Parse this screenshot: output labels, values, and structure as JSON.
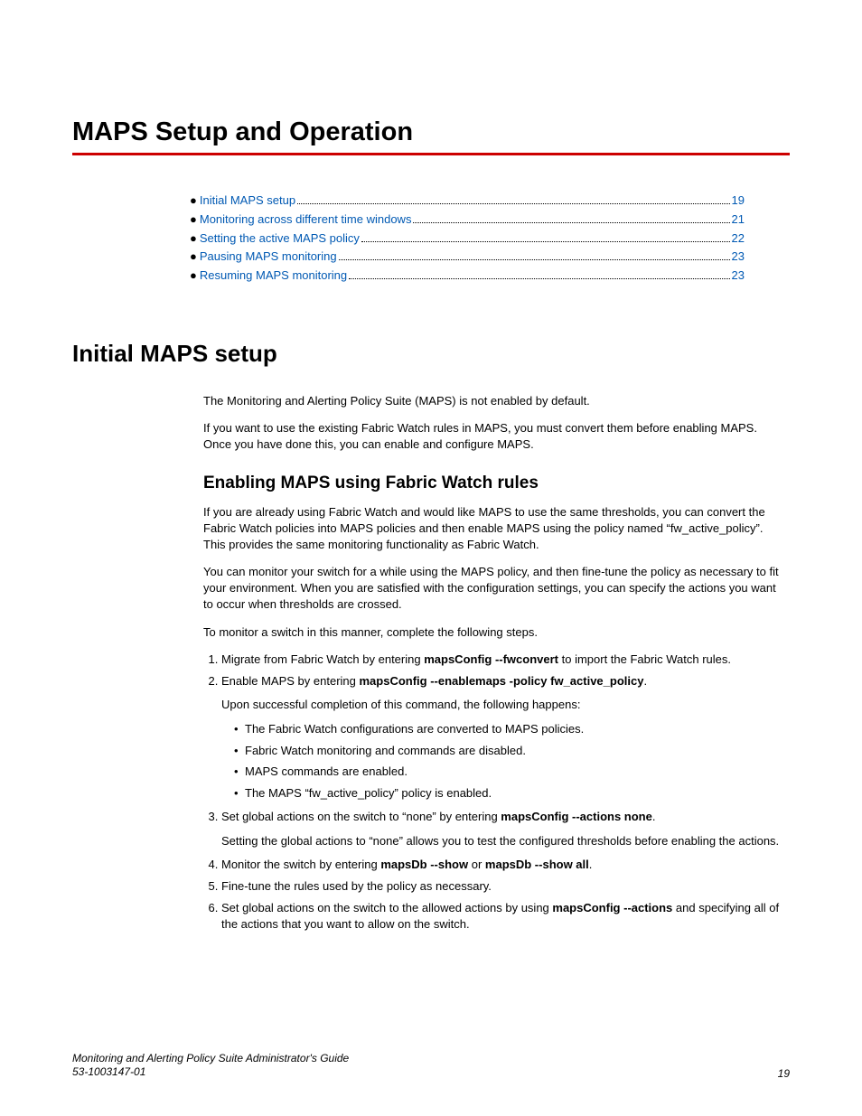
{
  "part_title": "MAPS Setup and Operation",
  "toc": [
    {
      "label": "Initial MAPS setup",
      "page": "19"
    },
    {
      "label": "Monitoring across different time windows",
      "page": "21"
    },
    {
      "label": "Setting the active MAPS policy",
      "page": "22"
    },
    {
      "label": "Pausing MAPS monitoring",
      "page": "23"
    },
    {
      "label": "Resuming MAPS monitoring",
      "page": "23"
    }
  ],
  "h1": "Initial MAPS setup",
  "intro_p1": "The Monitoring and Alerting Policy Suite (MAPS) is not enabled by default.",
  "intro_p2": "If you want to use the existing Fabric Watch rules in MAPS, you must convert them before enabling MAPS. Once you have done this, you can enable and configure MAPS.",
  "h2": "Enabling MAPS using Fabric Watch rules",
  "body_p1": "If you are already using Fabric Watch and would like MAPS to use the same thresholds, you can convert the Fabric Watch policies into MAPS policies and then enable MAPS using the policy named “fw_active_policy”. This provides the same monitoring functionality as Fabric Watch.",
  "body_p2": "You can monitor your switch for a while using the MAPS policy, and then fine-tune the policy as necessary to fit your environment. When you are satisfied with the configuration settings, you can specify the actions you want to occur when thresholds are crossed.",
  "body_p3": "To monitor a switch in this manner, complete the following steps.",
  "step1_a": "Migrate from Fabric Watch by entering ",
  "step1_b": "mapsConfig --fwconvert",
  "step1_c": " to import the Fabric Watch rules.",
  "step2_a": "Enable MAPS by entering ",
  "step2_b": "mapsConfig --enablemaps -policy fw_active_policy",
  "step2_c": ".",
  "step2_sub": "Upon successful completion of this command, the following happens:",
  "step2_bullets": [
    "The Fabric Watch configurations are converted to MAPS policies.",
    "Fabric Watch monitoring and commands are disabled.",
    "MAPS commands are enabled.",
    "The MAPS “fw_active_policy” policy is enabled."
  ],
  "step3_a": "Set global actions on the switch to “none” by entering ",
  "step3_b": "mapsConfig --actions none",
  "step3_c": ".",
  "step3_sub": "Setting the global actions to “none” allows you to test the configured thresholds before enabling the actions.",
  "step4_a": "Monitor the switch by entering ",
  "step4_b": "mapsDb --show",
  "step4_c": " or ",
  "step4_d": "mapsDb --show all",
  "step4_e": ".",
  "step5": "Fine-tune the rules used by the policy as necessary.",
  "step6_a": "Set global actions on the switch to the allowed actions by using ",
  "step6_b": "mapsConfig --actions",
  "step6_c": " and specifying all of the actions that you want to allow on the switch.",
  "footer_title": "Monitoring and Alerting Policy Suite Administrator's Guide",
  "footer_doc": "53-1003147-01",
  "footer_page": "19"
}
